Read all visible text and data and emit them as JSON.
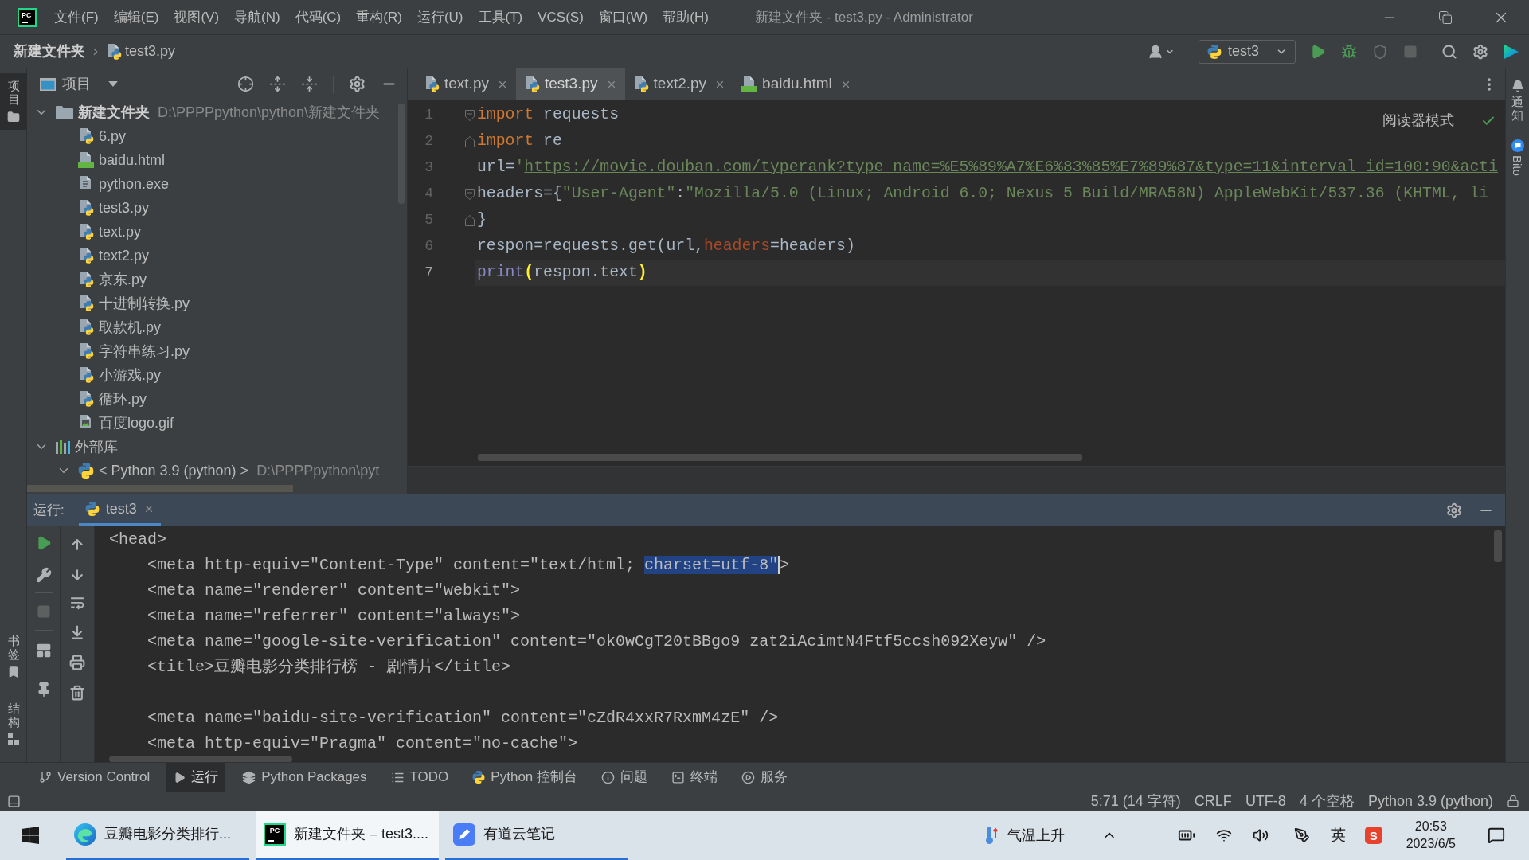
{
  "title_bar": {
    "logo": "PC",
    "menu": [
      "文件(F)",
      "编辑(E)",
      "视图(V)",
      "导航(N)",
      "代码(C)",
      "重构(R)",
      "运行(U)",
      "工具(T)",
      "VCS(S)",
      "窗口(W)",
      "帮助(H)"
    ],
    "title": "新建文件夹 - test3.py - Administrator"
  },
  "navigation_bar": {
    "breadcrumbs": [
      {
        "label": "新建文件夹",
        "kind": "folder"
      },
      {
        "label": "test3.py",
        "kind": "python"
      }
    ],
    "run_configuration": "test3"
  },
  "left_strip": {
    "top": [
      {
        "label": "项目",
        "kind": "project",
        "selected": true
      }
    ],
    "bottom": [
      {
        "label": "书签",
        "kind": "bookmarks",
        "selected": false
      },
      {
        "label": "结构",
        "kind": "structure",
        "selected": false
      }
    ]
  },
  "project_panel": {
    "title": "项目",
    "tree": [
      {
        "label": "新建文件夹",
        "kind": "project",
        "path": "D:\\PPPPpython\\python\\新建文件夹",
        "expanded": true,
        "children": [
          {
            "label": "6.py",
            "kind": "python"
          },
          {
            "label": "baidu.html",
            "kind": "html"
          },
          {
            "label": "python.exe",
            "kind": "exe"
          },
          {
            "label": "test3.py",
            "kind": "python"
          },
          {
            "label": "text.py",
            "kind": "python"
          },
          {
            "label": "text2.py",
            "kind": "python"
          },
          {
            "label": "京东.py",
            "kind": "python"
          },
          {
            "label": "十进制转换.py",
            "kind": "python"
          },
          {
            "label": "取款机.py",
            "kind": "python"
          },
          {
            "label": "字符串练习.py",
            "kind": "python"
          },
          {
            "label": "小游戏.py",
            "kind": "python"
          },
          {
            "label": "循环.py",
            "kind": "python"
          },
          {
            "label": "百度logo.gif",
            "kind": "image"
          }
        ]
      },
      {
        "label": "外部库",
        "kind": "library",
        "expanded": true,
        "children": [
          {
            "label": "< Python 3.9 (python) >",
            "kind": "sdk",
            "path": "D:\\PPPPpython\\pyt",
            "expanded": true
          }
        ]
      }
    ]
  },
  "editor": {
    "tabs": [
      {
        "label": "text.py",
        "kind": "python",
        "selected": false
      },
      {
        "label": "test3.py",
        "kind": "python",
        "selected": true
      },
      {
        "label": "text2.py",
        "kind": "python",
        "selected": false
      },
      {
        "label": "baidu.html",
        "kind": "html",
        "selected": false
      }
    ],
    "reader_mode": "阅读器模式",
    "lines": [
      {
        "number": "1",
        "fold": {
          "kind": "start"
        },
        "current": false,
        "tokens": [
          {
            "kind": "keyword",
            "text": "import"
          },
          {
            "kind": "plain",
            "text": " requests"
          }
        ]
      },
      {
        "number": "2",
        "fold": {
          "kind": "end"
        },
        "current": false,
        "tokens": [
          {
            "kind": "keyword",
            "text": "import"
          },
          {
            "kind": "plain",
            "text": " re"
          }
        ]
      },
      {
        "number": "3",
        "current": false,
        "tokens": [
          {
            "kind": "plain",
            "text": "url="
          },
          {
            "kind": "string",
            "text": "'"
          },
          {
            "kind": "link",
            "text": "https://movie.douban.com/typerank?type_name=%E5%89%A7%E6%83%85%E7%89%87&type=11&interval_id=100:90&acti"
          }
        ]
      },
      {
        "number": "4",
        "fold": {
          "kind": "start"
        },
        "current": false,
        "tokens": [
          {
            "kind": "plain",
            "text": "headers={"
          },
          {
            "kind": "string",
            "text": "\"User-Agent\""
          },
          {
            "kind": "plain",
            "text": ":"
          },
          {
            "kind": "string",
            "text": "\"Mozilla/5.0 (Linux; Android 6.0; Nexus 5 Build/MRA58N) AppleWebKit/537.36 (KHTML, li"
          }
        ]
      },
      {
        "number": "5",
        "fold": {
          "kind": "end"
        },
        "current": false,
        "tokens": [
          {
            "kind": "plain",
            "text": "}"
          }
        ]
      },
      {
        "number": "6",
        "current": false,
        "tokens": [
          {
            "kind": "plain",
            "text": "respon=requests.get(url,"
          },
          {
            "kind": "param",
            "text": "headers"
          },
          {
            "kind": "plain",
            "text": "=headers)"
          }
        ]
      },
      {
        "number": "7",
        "current": true,
        "tokens": [
          {
            "kind": "builtin",
            "text": "print"
          },
          {
            "kind": "brace",
            "text": "("
          },
          {
            "kind": "plain",
            "text": "respon.text"
          },
          {
            "kind": "brace",
            "text": ")"
          }
        ]
      }
    ]
  },
  "right_strip": [
    {
      "label": "通知",
      "kind": "notifications"
    },
    {
      "label": "Bito",
      "kind": "plugin"
    }
  ],
  "run_panel": {
    "label": "运行:",
    "tabs": [
      {
        "label": "test3",
        "selected": true
      }
    ],
    "output": [
      {
        "kind": "text",
        "segments": [
          {
            "text": "<head>",
            "selected": false
          }
        ]
      },
      {
        "kind": "text",
        "segments": [
          {
            "text": "    <meta http-equiv=\"Content-Type\" content=\"text/html; ",
            "selected": false
          },
          {
            "text": "charset=utf-8\"",
            "selected": true
          },
          {
            "text": ">",
            "selected": false
          }
        ]
      },
      {
        "kind": "text",
        "segments": [
          {
            "text": "    <meta name=\"renderer\" content=\"webkit\">",
            "selected": false
          }
        ]
      },
      {
        "kind": "text",
        "segments": [
          {
            "text": "    <meta name=\"referrer\" content=\"always\">",
            "selected": false
          }
        ]
      },
      {
        "kind": "text",
        "segments": [
          {
            "text": "    <meta name=\"google-site-verification\" content=\"ok0wCgT20tBBgo9_zat2iAcimtN4Ftf5ccsh092Xeyw\" />",
            "selected": false
          }
        ]
      },
      {
        "kind": "text",
        "segments": [
          {
            "text": "    <title>豆瓣电影分类排行榜 - 剧情片</title>",
            "selected": false
          }
        ]
      },
      {
        "kind": "blank"
      },
      {
        "kind": "text",
        "segments": [
          {
            "text": "    <meta name=\"baidu-site-verification\" content=\"cZdR4xxR7RxmM4zE\" />",
            "selected": false
          }
        ]
      },
      {
        "kind": "text",
        "segments": [
          {
            "text": "    <meta http-equiv=\"Pragma\" content=\"no-cache\">",
            "selected": false
          }
        ]
      }
    ]
  },
  "tool_windows": [
    {
      "label": "Version Control",
      "kind": "vcs",
      "selected": false
    },
    {
      "label": "运行",
      "kind": "run",
      "selected": true
    },
    {
      "label": "Python Packages",
      "kind": "packages",
      "selected": false
    },
    {
      "label": "TODO",
      "kind": "todo",
      "selected": false
    },
    {
      "label": "Python 控制台",
      "kind": "console",
      "selected": false
    },
    {
      "label": "问题",
      "kind": "problems",
      "selected": false
    },
    {
      "label": "终端",
      "kind": "terminal",
      "selected": false
    },
    {
      "label": "服务",
      "kind": "services",
      "selected": false
    }
  ],
  "status_bar": {
    "items": [
      "5:71 (14 字符)",
      "CRLF",
      "UTF-8",
      "4 个空格",
      "Python 3.9 (python)"
    ]
  },
  "taskbar": {
    "apps": [
      {
        "label": "豆瓣电影分类排行...",
        "kind": "browser",
        "selected": false
      },
      {
        "label": "新建文件夹 – test3....",
        "kind": "pycharm",
        "logo": "PC",
        "selected": true
      },
      {
        "label": "有道云笔记",
        "kind": "notes",
        "selected": false
      }
    ],
    "weather": "气温上升",
    "input_method": "英",
    "ime_logo": "S",
    "time": "20:53",
    "date": "2023/6/5"
  }
}
